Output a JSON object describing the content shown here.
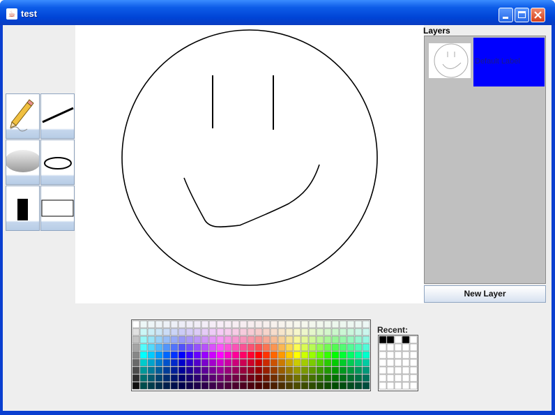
{
  "window": {
    "title": "test",
    "controls": [
      "minimize",
      "maximize",
      "close"
    ]
  },
  "tools": [
    {
      "name": "pencil-tool",
      "icon": "pencil-icon"
    },
    {
      "name": "line-tool",
      "icon": "line-icon"
    },
    {
      "name": "filled-oval-tool",
      "icon": "filled-oval-icon"
    },
    {
      "name": "oval-tool",
      "icon": "oval-icon"
    },
    {
      "name": "filled-rect-tool",
      "icon": "filled-rect-icon"
    },
    {
      "name": "rect-tool",
      "icon": "rect-icon"
    }
  ],
  "layers": {
    "title": "Layers",
    "items": [
      {
        "label": "Default Label",
        "color": "#0000ff"
      }
    ],
    "new_layer_label": "New Layer"
  },
  "palette": {
    "recent_label": "Recent:",
    "recent_colors": [
      "#000000",
      "#000000",
      "#ffffff",
      "#000000"
    ]
  }
}
